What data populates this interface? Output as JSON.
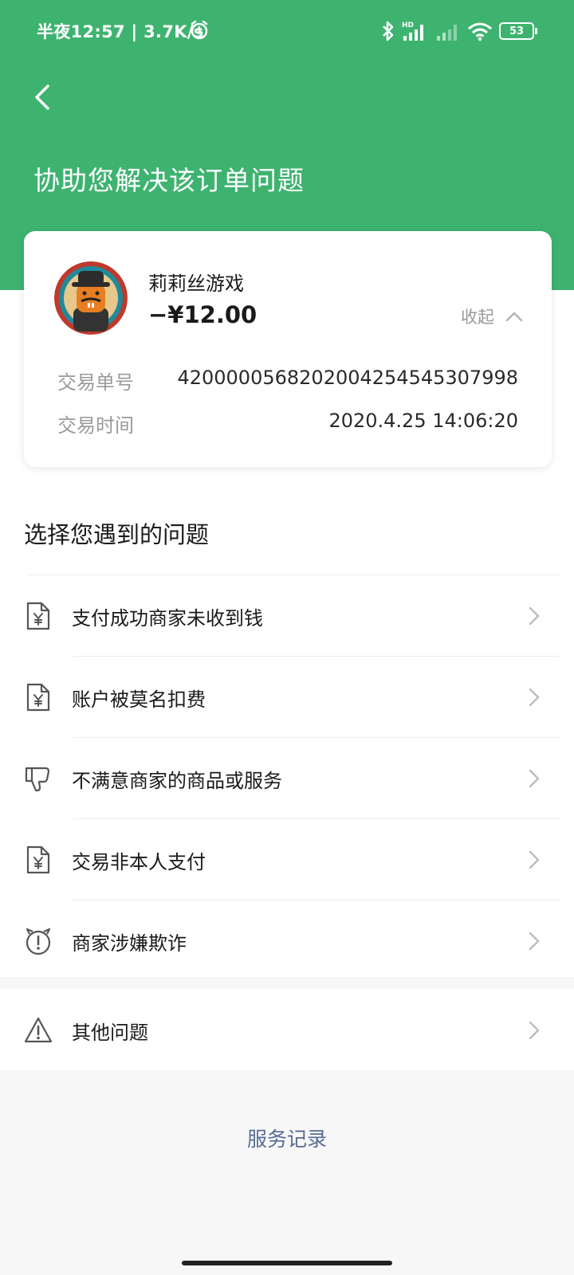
{
  "status_bar": {
    "time_speed": "半夜12:57 | 3.7K/s",
    "battery": "53",
    "hd_label": "HD"
  },
  "header": {
    "title": "协助您解决该订单问题"
  },
  "order": {
    "merchant": "莉莉丝游戏",
    "amount": "−¥12.00",
    "collapse_label": "收起",
    "details": [
      {
        "label": "交易单号",
        "value": "4200000568202004254545307998"
      },
      {
        "label": "交易时间",
        "value": "2020.4.25 14:06:20"
      }
    ]
  },
  "issues_section": {
    "title": "选择您遇到的问题",
    "items": [
      {
        "label": "支付成功商家未收到钱",
        "icon": "receipt-yen-icon"
      },
      {
        "label": "账户被莫名扣费",
        "icon": "receipt-yen-icon"
      },
      {
        "label": "不满意商家的商品或服务",
        "icon": "thumbs-down-icon"
      },
      {
        "label": "交易非本人支付",
        "icon": "receipt-yen-icon"
      },
      {
        "label": "商家涉嫌欺诈",
        "icon": "alert-circle-icon"
      }
    ]
  },
  "other": {
    "label": "其他问题",
    "icon": "warning-triangle-icon"
  },
  "footer": {
    "service_record": "服务记录"
  },
  "colors": {
    "brand_green": "#3eb370",
    "link_blue": "#576b95"
  }
}
